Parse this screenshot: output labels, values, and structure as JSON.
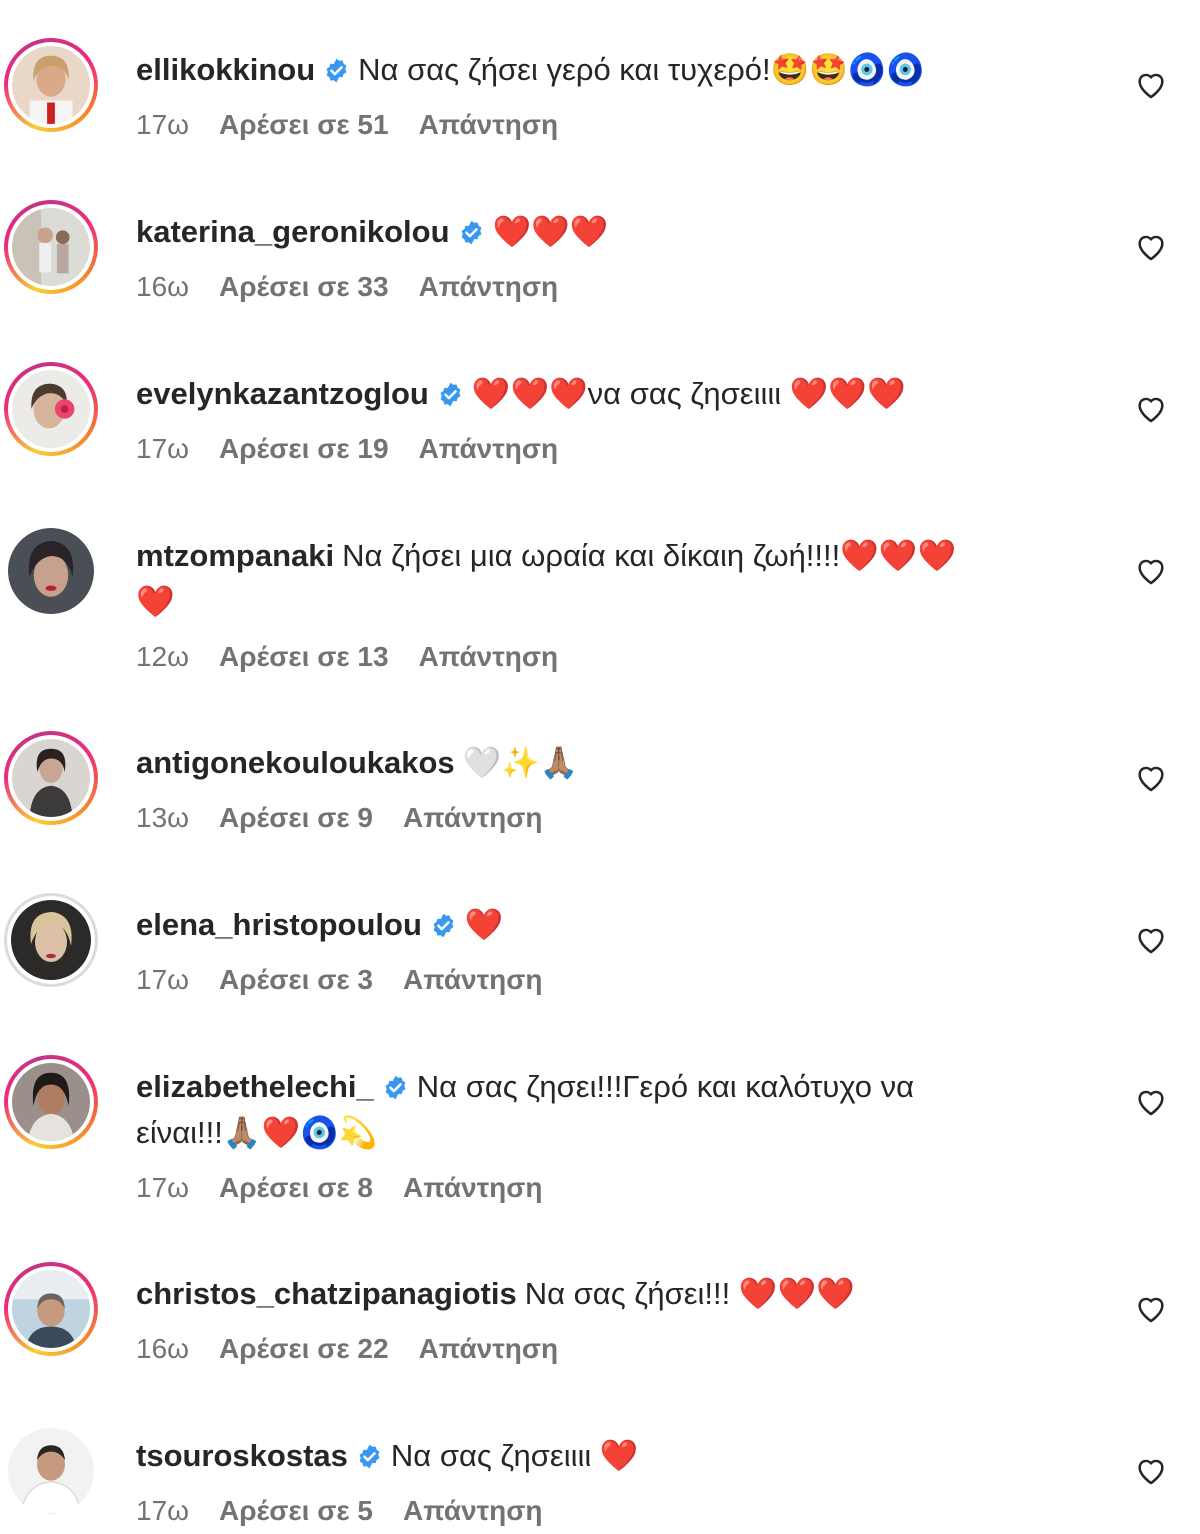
{
  "verified_color": "#3897f0",
  "comments": [
    {
      "username": "ellikokkinou",
      "verified": true,
      "text": "Να σας ζήσει γερό και τυχερό!🤩🤩🧿🧿",
      "time": "17ω",
      "likes": "Αρέσει σε 51",
      "reply": "Απάντηση"
    },
    {
      "username": "katerina_geronikolou",
      "verified": true,
      "text": "❤️❤️❤️",
      "time": "16ω",
      "likes": "Αρέσει σε 33",
      "reply": "Απάντηση"
    },
    {
      "username": "evelynkazantzoglou",
      "verified": true,
      "text": "❤️❤️❤️να σας ζησειιιι ❤️❤️❤️",
      "time": "17ω",
      "likes": "Αρέσει σε 19",
      "reply": "Απάντηση"
    },
    {
      "username": "mtzompanaki",
      "verified": false,
      "text": "Να ζήσει μια ωραία και δίκαιη ζωή!!!!❤️❤️❤️",
      "text_line2": "❤️",
      "time": "12ω",
      "likes": "Αρέσει σε 13",
      "reply": "Απάντηση"
    },
    {
      "username": "antigonekouloukakos",
      "verified": false,
      "text": "🤍✨🙏🏽",
      "time": "13ω",
      "likes": "Αρέσει σε 9",
      "reply": "Απάντηση"
    },
    {
      "username": "elena_hristopoulou",
      "verified": true,
      "text": "❤️",
      "time": "17ω",
      "likes": "Αρέσει σε 3",
      "reply": "Απάντηση"
    },
    {
      "username": "elizabethelechi_",
      "verified": true,
      "text": "Να σας ζησει!!!Γερό και καλότυχο να",
      "text_line2": "είναι!!!🙏🏽❤️🧿💫",
      "time": "17ω",
      "likes": "Αρέσει σε 8",
      "reply": "Απάντηση"
    },
    {
      "username": "christos_chatzipanagiotis",
      "verified": false,
      "text": "Να σας ζήσει!!! ❤️❤️❤️",
      "time": "16ω",
      "likes": "Αρέσει σε 22",
      "reply": "Απάντηση"
    },
    {
      "username": "tsouroskostas",
      "verified": true,
      "text": "Να σας ζησειιιι ❤️",
      "time": "17ω",
      "likes": "Αρέσει σε 5",
      "reply": "Απάντηση"
    }
  ],
  "icons": {
    "like": "heart-outline-icon",
    "verified": "verified-badge-icon"
  }
}
